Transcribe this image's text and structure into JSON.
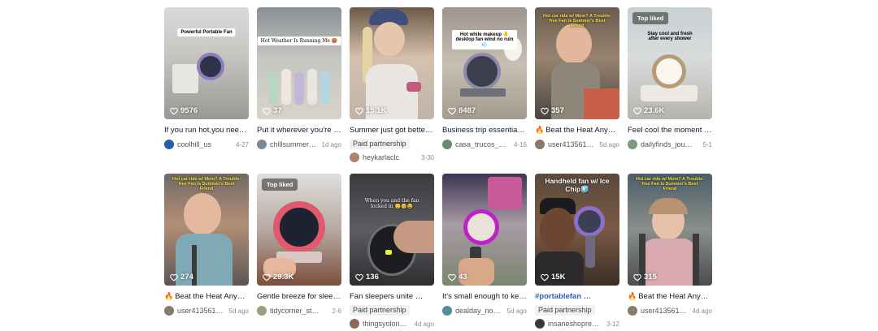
{
  "videos": [
    {
      "likes": "9576",
      "title": "If you run hot,you need this…",
      "user": "coolhill_us",
      "date": "4-27",
      "caption": "Powerful Portable Fan",
      "top_liked": "",
      "paid": "",
      "avatar_color": "#2a5aa8"
    },
    {
      "likes": "37",
      "title": "Put it wherever you're …",
      "user": "chillsummer…",
      "date": "1d ago",
      "caption": "Hot Weather Is Running Me 🥵",
      "top_liked": "",
      "paid": "",
      "avatar_color": "#7a8a9a"
    },
    {
      "likes": "15.1K",
      "title": "Summer just got better…",
      "user": "heykarlaclc",
      "date": "3-30",
      "caption": "",
      "top_liked": "",
      "paid": "Paid partnership",
      "avatar_color": "#b08070"
    },
    {
      "likes": "8487",
      "title": "Business trip essential:…",
      "user": "casa_trucos_d…",
      "date": "4-16",
      "caption": "Hot while makeup 🤚 desktop fan wind no ruin 💨",
      "top_liked": "",
      "paid": "",
      "avatar_color": "#6a8a6a"
    },
    {
      "likes": "357",
      "title": "Beat the Heat Anyw…",
      "user": "user413561…",
      "date": "5d ago",
      "caption": "Hot car ride w/ Mom? A Trouble-free Fan is Summer's Best Friend",
      "top_liked": "",
      "paid": "",
      "avatar_color": "#8a7a6a",
      "fire": "🔥"
    },
    {
      "likes": "23.6K",
      "title": "Feel cool the moment …",
      "user": "dailyfinds_jou…",
      "date": "5-1",
      "caption": "Stay cool and fresh after every shower",
      "top_liked": "Top liked",
      "paid": "",
      "avatar_color": "#7a9a7a"
    },
    {
      "likes": "274",
      "title": "Beat the Heat Anyw…",
      "user": "user413561…",
      "date": "5d ago",
      "caption": "Hot car ride w/ Mom? A Trouble-free Fan is Summer's Best Friend",
      "top_liked": "",
      "paid": "",
      "avatar_color": "#8a7a6a",
      "fire": "🔥"
    },
    {
      "likes": "29.3K",
      "title": "Gentle breeze for slee…",
      "user": "tidycorner_stu…",
      "date": "2-6",
      "caption": "",
      "top_liked": "Top liked",
      "paid": "",
      "avatar_color": "#9aa07a"
    },
    {
      "likes": "136",
      "title": "Fan sleepers unite …",
      "user": "thingsyolon…",
      "date": "4d ago",
      "caption": "When you and the fan locked in 😴🥺😂",
      "top_liked": "",
      "paid": "Paid partnership",
      "avatar_color": "#8a6a5a"
    },
    {
      "likes": "43",
      "title": "It's small enough to ke…",
      "user": "dealday_no…",
      "date": "5d ago",
      "caption": "",
      "top_liked": "",
      "paid": "",
      "avatar_color": "#5a8a9a"
    },
    {
      "likes": "15K",
      "title": "#portablefan …",
      "user": "insaneshopre…",
      "date": "3-12",
      "caption": "Handheld fan w/ Ice Chip🧊",
      "top_liked": "",
      "paid": "Paid partnership",
      "avatar_color": "#3a3a3a",
      "tag": true
    },
    {
      "likes": "315",
      "title": "Beat the Heat Anyw…",
      "user": "user413561…",
      "date": "4d ago",
      "caption": "Hot car ride w/ Mom? A Trouble-free Fan is Summer's Best Friend",
      "top_liked": "",
      "paid": "",
      "avatar_color": "#8a7a6a",
      "fire": "🔥"
    }
  ],
  "icons": {
    "likes": "heart-outline-icon"
  },
  "colors": {
    "title": "#161823",
    "hashtag": "#2b5db9",
    "meta": "#8a8b91",
    "paid_bg": "#f1f1f2"
  }
}
